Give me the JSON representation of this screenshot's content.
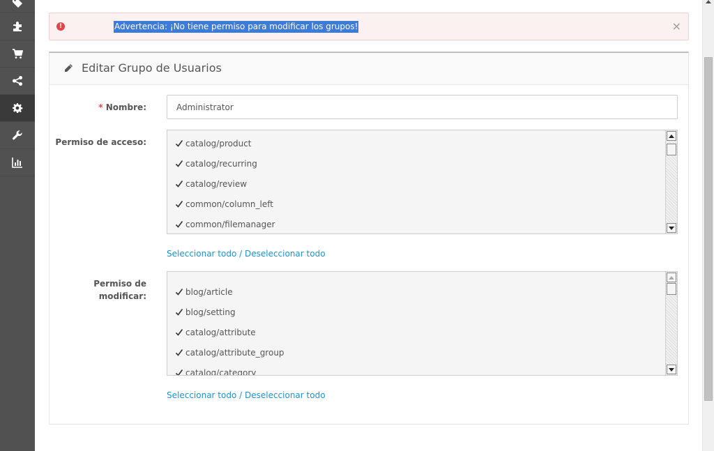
{
  "sidebar": {
    "items": [
      {
        "icon": "tags-icon",
        "active": false
      },
      {
        "icon": "puzzle-icon",
        "active": false
      },
      {
        "icon": "shopping-cart-icon",
        "active": false
      },
      {
        "icon": "share-icon",
        "active": false
      },
      {
        "icon": "gear-icon",
        "active": true
      },
      {
        "icon": "wrench-icon",
        "active": false
      },
      {
        "icon": "bar-chart-icon",
        "active": false
      }
    ]
  },
  "alert": {
    "icon": "exclamation-circle-icon",
    "text": "Advertencia: ¡No tiene permiso para modificar los grupos!",
    "close": "×"
  },
  "panel": {
    "icon": "pencil-icon",
    "title": "Editar Grupo de Usuarios"
  },
  "form": {
    "name": {
      "required_mark": "*",
      "label": "Nombre:",
      "value": "Administrator"
    },
    "access": {
      "label": "Permiso de acceso:",
      "items": [
        {
          "label": "catalog/product",
          "checked": true
        },
        {
          "label": "catalog/recurring",
          "checked": true
        },
        {
          "label": "catalog/review",
          "checked": true
        },
        {
          "label": "common/column_left",
          "checked": true
        },
        {
          "label": "common/filemanager",
          "checked": true
        }
      ],
      "select_all": "Seleccionar todo",
      "separator": " / ",
      "deselect_all": "Deseleccionar todo"
    },
    "modify": {
      "label_line1": "Permiso de",
      "label_line2": "modificar:",
      "items": [
        {
          "label": "blog/article",
          "checked": true
        },
        {
          "label": "blog/setting",
          "checked": true
        },
        {
          "label": "catalog/attribute",
          "checked": true
        },
        {
          "label": "catalog/attribute_group",
          "checked": true
        },
        {
          "label": "catalog/category",
          "checked": true
        }
      ],
      "select_all": "Seleccionar todo",
      "separator": " / ",
      "deselect_all": "Deseleccionar todo"
    }
  },
  "colors": {
    "sidebar_bg": "#515151",
    "alert_bg": "#fcf1f1",
    "alert_icon": "#e0454e",
    "selection": "#3c7bd7",
    "link": "#1e91cf"
  }
}
